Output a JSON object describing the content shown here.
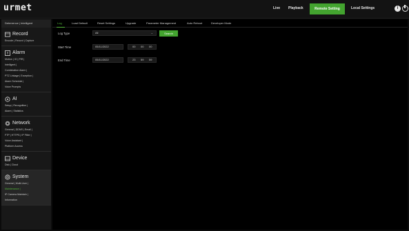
{
  "app": {
    "logo": "urmet"
  },
  "topnav": {
    "items": [
      "Live",
      "Playback",
      "Remote Setting",
      "Local Settings"
    ],
    "active": "Remote Setting"
  },
  "sidebar": {
    "top_row": "Deterrence | Intelligent",
    "sections": [
      {
        "title": "Record",
        "icon": "record-icon",
        "subs": [
          "Encode | Record | Capture"
        ]
      },
      {
        "title": "Alarm",
        "icon": "alarm-icon",
        "subs": [
          "Motion | IO | PIR |",
          "Intelligent |",
          "Combination Alarm |",
          "PTZ Linkage | Exception |",
          "Alarm Schedule |",
          "Voice Prompts"
        ]
      },
      {
        "title": "AI",
        "icon": "ai-icon",
        "subs": [
          "Setup | Recognition |",
          "Alarm | Statistics"
        ]
      },
      {
        "title": "Network",
        "icon": "network-icon",
        "subs": [
          "General | DDNS | Email |",
          "FTP | HTTPS | IP Filter |",
          "Voice Assistant |",
          "Platform Access"
        ]
      },
      {
        "title": "Device",
        "icon": "device-icon",
        "subs": [
          "Disk | Cloud"
        ]
      },
      {
        "title": "System",
        "icon": "system-icon",
        "subs": [
          "General | Multi-User |",
          "Maintenance |",
          "IP Camera Maintain |",
          "Information"
        ]
      }
    ]
  },
  "tabs": [
    "Log",
    "Load Default",
    "Reset Settings",
    "Upgrade",
    "Parameter Management",
    "Auto Reboot",
    "Developer Mode"
  ],
  "form": {
    "log_type_label": "Log Type",
    "log_type_value": "All",
    "search_label": "Search",
    "start_time_label": "Start Time",
    "start_date": "05/11/2022",
    "start_h": "00",
    "start_m": "00",
    "start_s": "00",
    "end_time_label": "End Time",
    "end_date": "05/11/2022",
    "end_h": "23",
    "end_m": "59",
    "end_s": "59"
  },
  "colors": {
    "accent": "#43a42f",
    "accent_text": "#53b53a",
    "background": "#000000",
    "sidebar": "#181818"
  }
}
